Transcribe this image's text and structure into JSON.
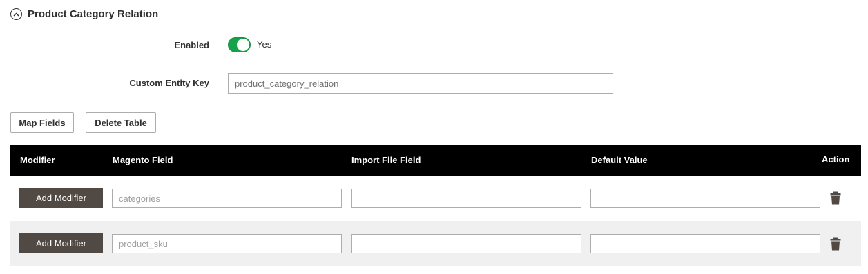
{
  "section": {
    "title": "Product Category Relation",
    "icon": "collapse-circle-chevron-up-icon"
  },
  "enabled": {
    "label": "Enabled",
    "value_label": "Yes",
    "on": true,
    "color": "#15a34a"
  },
  "entity_key": {
    "label": "Custom Entity Key",
    "value": "product_category_relation"
  },
  "buttons": {
    "map_fields": "Map Fields",
    "delete_table": "Delete Table"
  },
  "table": {
    "columns": [
      "Modifier",
      "Magento Field",
      "Import File Field",
      "Default Value",
      "Action"
    ],
    "header_color": "#000000",
    "rows": [
      {
        "modifier_label": "Add Modifier",
        "magento_field": "categories",
        "import_file_field": "",
        "default_value": "",
        "action_icon": "trash-icon"
      },
      {
        "modifier_label": "Add Modifier",
        "magento_field": "product_sku",
        "import_file_field": "",
        "default_value": "",
        "action_icon": "trash-icon"
      }
    ]
  }
}
